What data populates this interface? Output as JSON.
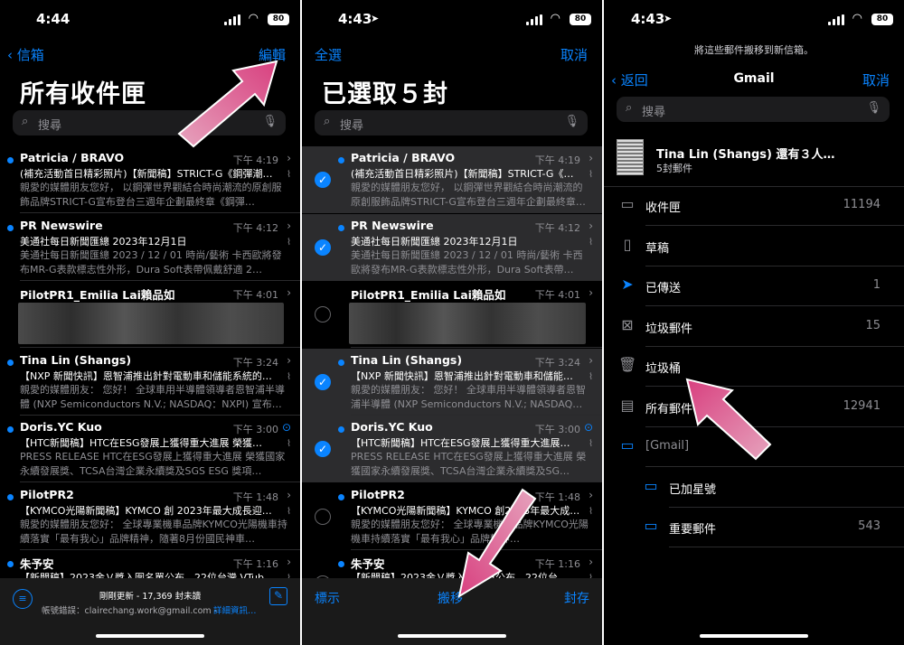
{
  "panel1": {
    "status": {
      "time": "4:44",
      "battery": "80"
    },
    "back_label": "信箱",
    "edit_label": "編輯",
    "title": "所有收件匣",
    "search_placeholder": "搜尋",
    "mails": [
      {
        "sender": "Patricia / BRAVO",
        "time": "下午 4:19",
        "subject": "(補充活動首日精彩照片)【新聞稿】STRICT-G《鋼彈潮…",
        "preview": "親愛的媒體朋友您好， 以鋼彈世界觀結合時尚潮流的原創服飾品牌STRICT-G宣布登台三週年企劃最終章《鋼彈…"
      },
      {
        "sender": "PR Newswire",
        "time": "下午 4:12",
        "subject": "美通社每日新聞匯總 2023年12月1日",
        "preview": "美通社每日新聞匯總 2023 / 12 / 01 時尚/藝術 卡西歐將發布MR-G表款標志性外形，Dura Soft表帶佩戴舒適 2…"
      },
      {
        "sender": "PilotPR1_Emilia Lai賴品如",
        "time": "下午 4:01",
        "subject": "",
        "preview": ""
      },
      {
        "sender": "Tina Lin (Shangs)",
        "time": "下午 3:24",
        "subject": "【NXP 新聞快訊】恩智浦推出針對電動車和儲能系統的…",
        "preview": "親愛的媒體朋友： 您好！ 全球車用半導體領導者恩智浦半導體 (NXP Semiconductors N.V.; NASDAQ：NXPI) 宣布…"
      },
      {
        "sender": "Doris.YC Kuo",
        "time": "下午 3:00",
        "subject": "【HTC新聞稿】HTC在ESG發展上獲得重大進展 榮獲…",
        "preview": "PRESS RELEASE HTC在ESG發展上獲得重大進展 榮獲國家永續發展獎、TCSA台灣企業永續獎及SGS ESG 獎項…"
      },
      {
        "sender": "PilotPR2",
        "time": "下午 1:48",
        "subject": "【KYMCO光陽新聞稿】KYMCO 創 2023年最大成長迎…",
        "preview": "親愛的媒體朋友您好： 全球專業機車品牌KYMCO光陽機車持續落實「最有我心」品牌精神，隨著8月份國民神車…"
      },
      {
        "sender": "朱予安",
        "time": "下午 1:16",
        "subject": "【新聞稿】2023金Ｖ獎入圍名單公布，22位台灣 VTub…",
        "preview": ""
      }
    ],
    "toolbar": {
      "updated": "剛剛更新 - 17,369 封未讀",
      "account_error": "帳號錯誤：clairechang.work@gmail.com -",
      "details": "詳細資訊…"
    }
  },
  "panel2": {
    "status": {
      "time": "4:43",
      "battery": "80"
    },
    "select_all": "全選",
    "cancel": "取消",
    "title": "已選取５封",
    "search_placeholder": "搜尋",
    "mails": [
      {
        "sender": "Patricia / BRAVO",
        "time": "下午 4:19",
        "subject": "(補充活動首日精彩照片)【新聞稿】STRICT-G《…",
        "preview": "親愛的媒體朋友您好， 以鋼彈世界觀結合時尚潮流的原創服飾品牌STRICT-G宣布登台三週年企劃最終章…"
      },
      {
        "sender": "PR Newswire",
        "time": "下午 4:12",
        "subject": "美通社每日新聞匯總 2023年12月1日",
        "preview": "美通社每日新聞匯總 2023 / 12 / 01 時尚/藝術 卡西歐將發布MR-G表款標志性外形，Dura Soft表帶…"
      },
      {
        "sender": "PilotPR1_Emilia Lai賴品如",
        "time": "下午 4:01",
        "subject": "",
        "preview": ""
      },
      {
        "sender": "Tina Lin (Shangs)",
        "time": "下午 3:24",
        "subject": "【NXP 新聞快訊】恩智浦推出針對電動車和儲能…",
        "preview": "親愛的媒體朋友： 您好！ 全球車用半導體領導者恩智浦半導體 (NXP Semiconductors N.V.; NASDAQ…"
      },
      {
        "sender": "Doris.YC Kuo",
        "time": "下午 3:00",
        "subject": "【HTC新聞稿】HTC在ESG發展上獲得重大進展…",
        "preview": "PRESS RELEASE HTC在ESG發展上獲得重大進展 榮獲國家永續發展獎、TCSA台灣企業永續獎及SG…"
      },
      {
        "sender": "PilotPR2",
        "time": "下午 1:48",
        "subject": "【KYMCO光陽新聞稿】KYMCO 創2023年最大成…",
        "preview": "親愛的媒體朋友您好： 全球專業機車品牌KYMCO光陽機車持續落實「最有我心」品牌精神…"
      },
      {
        "sender": "朱予安",
        "time": "下午 1:16",
        "subject": "【新聞稿】2023金Ｖ獎入圍名單公布，22位台…",
        "preview": ""
      }
    ],
    "toolbar": {
      "mark": "標示",
      "move": "搬移",
      "archive": "封存"
    }
  },
  "panel3": {
    "status": {
      "time": "4:43",
      "battery": "80"
    },
    "hint": "將這些郵件搬移到新信箱。",
    "back": "返回",
    "title": "Gmail",
    "cancel": "取消",
    "search_placeholder": "搜尋",
    "thread": {
      "from": "Tina Lin (Shangs) 還有３人…",
      "count": "5封郵件"
    },
    "folders": [
      {
        "name": "收件匣",
        "count": "11194",
        "icon": "inbox-icon"
      },
      {
        "name": "草稿",
        "count": "",
        "icon": "draft-icon"
      },
      {
        "name": "已傳送",
        "count": "1",
        "icon": "sent-icon"
      },
      {
        "name": "垃圾郵件",
        "count": "15",
        "icon": "junk-icon"
      },
      {
        "name": "垃圾桶",
        "count": "",
        "icon": "trash-icon"
      },
      {
        "name": "所有郵件",
        "count": "12941",
        "icon": "archive-icon"
      },
      {
        "name": "[Gmail]",
        "count": "",
        "icon": "folder-icon"
      },
      {
        "name": "已加星號",
        "count": "",
        "icon": "folder-icon"
      },
      {
        "name": "重要郵件",
        "count": "543",
        "icon": "folder-icon"
      }
    ]
  },
  "colors": {
    "accent": "#0a84ff",
    "arrow": "#e0508a",
    "background": "#000000"
  }
}
